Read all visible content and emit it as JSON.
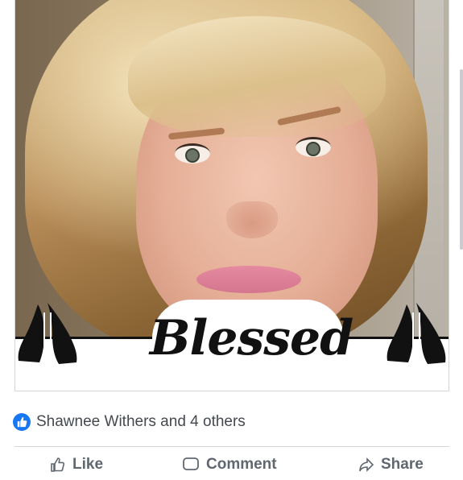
{
  "post": {
    "image_caption": "Blessed",
    "reactions": {
      "summary": "Shawnee Withers and 4 others",
      "icon": "like-thumb-icon",
      "icon_color": "#1877f2"
    },
    "actions": {
      "like_label": "Like",
      "comment_label": "Comment",
      "share_label": "Share"
    }
  }
}
